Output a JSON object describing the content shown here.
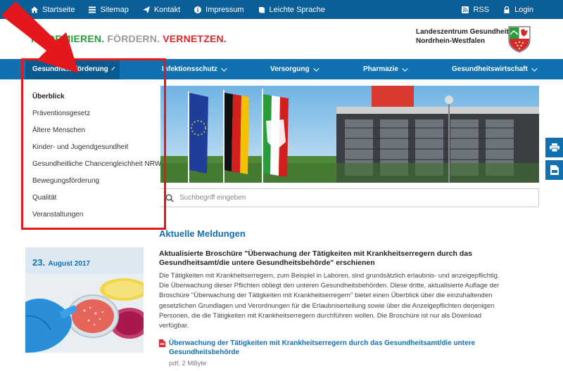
{
  "topbar": {
    "left_items": [
      {
        "icon": "home-icon",
        "label": "Startseite"
      },
      {
        "icon": "sitemap-icon",
        "label": "Sitemap"
      },
      {
        "icon": "send-icon",
        "label": "Kontakt"
      },
      {
        "icon": "info-icon",
        "label": "Impressum"
      },
      {
        "icon": "book-icon",
        "label": "Leichte Sprache"
      }
    ],
    "right_items": [
      {
        "icon": "rss-icon",
        "label": "RSS"
      },
      {
        "icon": "lock-icon",
        "label": "Login"
      }
    ]
  },
  "header": {
    "tagline_w1": "INFORMIEREN.",
    "tagline_w2": "FÖRDERN.",
    "tagline_w3": "VERNETZEN.",
    "org_line1": "Landeszentrum Gesundheit",
    "org_line2": "Nordrhein-Westfalen"
  },
  "mainnav": {
    "items": [
      {
        "label": "Gesundheitsförderung"
      },
      {
        "label": "Infektionsschutz"
      },
      {
        "label": "Versorgung"
      },
      {
        "label": "Pharmazie"
      },
      {
        "label": "Gesundheitswirtschaft"
      }
    ]
  },
  "dropdown": {
    "items": [
      "Überblick",
      "Präventionsgesetz",
      "Ältere Menschen",
      "Kinder- und Jugendgesundheit",
      "Gesundheitliche Chancengleichheit NRW",
      "Bewegungsförderung",
      "Qualität",
      "Veranstaltungen"
    ]
  },
  "search": {
    "placeholder": "Suchbegriff eingeben"
  },
  "news": {
    "section_title": "Aktuelle Meldungen",
    "date_day": "23.",
    "date_month": "August 2017",
    "headline": "Aktualisierte Broschüre \"Überwachung der Tätigkeiten mit Krankheitserregern durch das Gesundheitsamt/die untere Gesundheitsbehörde\" erschienen",
    "body": "Die Tätigkeiten mit Krankheitserregern, zum Beispiel in Laboren, sind grundsätzlich erlaubnis- und anzeigepflichtig. Die Überwachung dieser Pflichten obliegt den unteren Gesundheitsbehörden. Diese dritte, aktualisierte Auflage der Broschüre \"Überwachung der Tätigkeiten mit Krankheitserregern\" bietet einen Überblick über die einzuhaltenden gesetzlichen Grundlagen und Verordnungen für die Erlaubniserteilung sowie über die Anzeigepflichten derjenigen Personen, die die Tätigkeiten mit Krankheitserregern durchführen wollen. Die Broschüre ist nur als Download verfügbar.",
    "download_label": "Überwachung der Tätigkeiten mit Krankheitserregern durch das Gesundheitsamt/die untere Gesundheitsbehörde",
    "download_meta": "pdf, 2 MByte"
  },
  "colors": {
    "topbar": "#0b5f96",
    "nav": "#1170b0",
    "highlight": "#e3171c",
    "tag_green": "#2c9b3e",
    "tag_grey": "#9a9a9a",
    "tag_red": "#d32b2b"
  }
}
